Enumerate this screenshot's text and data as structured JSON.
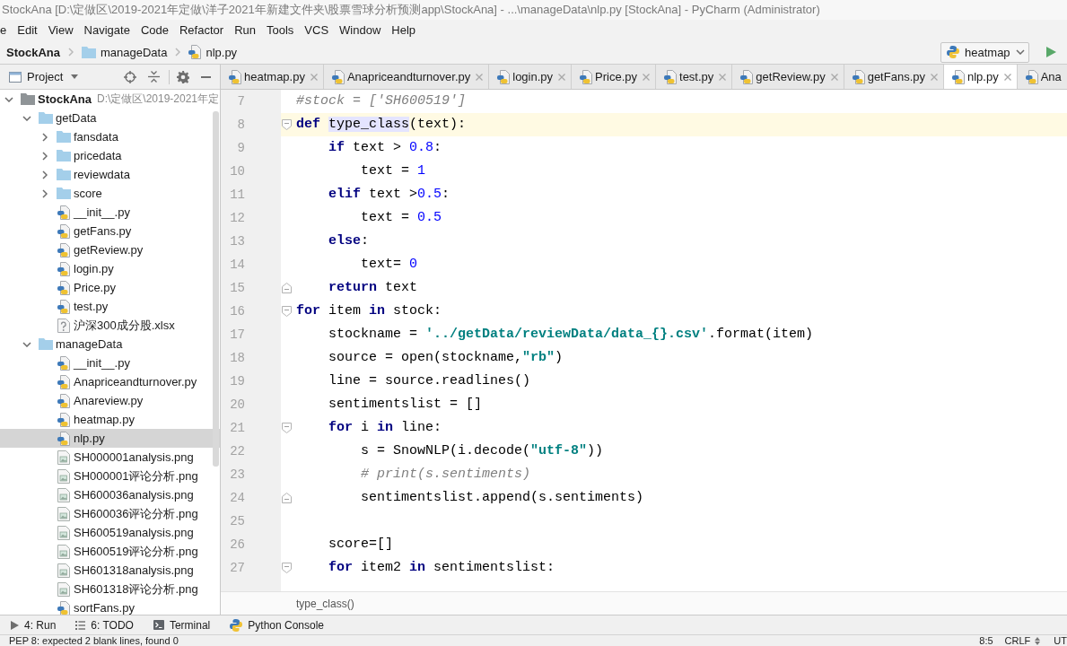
{
  "window": {
    "title": "StockAna [D:\\定做区\\2019-2021年定做\\洋子2021年新建文件夹\\股票雪球分析预测app\\StockAna] - ...\\manageData\\nlp.py [StockAna] - PyCharm (Administrator)"
  },
  "menu": [
    "e",
    "Edit",
    "View",
    "Navigate",
    "Code",
    "Refactor",
    "Run",
    "Tools",
    "VCS",
    "Window",
    "Help"
  ],
  "navigation": {
    "crumbs": [
      {
        "label": "StockAna",
        "kind": "root"
      },
      {
        "label": "manageData",
        "kind": "folder"
      },
      {
        "label": "nlp.py",
        "kind": "python"
      }
    ],
    "run_config": {
      "label": "heatmap"
    }
  },
  "project": {
    "title": "Project",
    "tree": [
      {
        "label": "StockAna",
        "path": "D:\\定做区\\2019-2021年定",
        "kind": "root",
        "expanded": true,
        "selected": false,
        "children": [
          {
            "label": "getData",
            "kind": "folder",
            "expanded": true,
            "selected": false,
            "children": [
              {
                "label": "fansdata",
                "kind": "folder",
                "expanded": false,
                "selected": false
              },
              {
                "label": "pricedata",
                "kind": "folder",
                "expanded": false,
                "selected": false
              },
              {
                "label": "reviewdata",
                "kind": "folder",
                "expanded": false,
                "selected": false
              },
              {
                "label": "score",
                "kind": "folder",
                "expanded": false,
                "selected": false
              },
              {
                "label": "__init__.py",
                "kind": "python",
                "selected": false
              },
              {
                "label": "getFans.py",
                "kind": "python",
                "selected": false
              },
              {
                "label": "getReview.py",
                "kind": "python",
                "selected": false
              },
              {
                "label": "login.py",
                "kind": "python",
                "selected": false
              },
              {
                "label": "Price.py",
                "kind": "python",
                "selected": false
              },
              {
                "label": "test.py",
                "kind": "python",
                "selected": false
              },
              {
                "label": "沪深300成分股.xlsx",
                "kind": "other",
                "selected": false
              }
            ]
          },
          {
            "label": "manageData",
            "kind": "folder",
            "expanded": true,
            "selected": false,
            "children": [
              {
                "label": "__init__.py",
                "kind": "python",
                "selected": false
              },
              {
                "label": "Anapriceandturnover.py",
                "kind": "python",
                "selected": false
              },
              {
                "label": "Anareview.py",
                "kind": "python",
                "selected": false
              },
              {
                "label": "heatmap.py",
                "kind": "python",
                "selected": false
              },
              {
                "label": "nlp.py",
                "kind": "python",
                "selected": true
              },
              {
                "label": "SH000001analysis.png",
                "kind": "image",
                "selected": false
              },
              {
                "label": "SH000001评论分析.png",
                "kind": "image",
                "selected": false
              },
              {
                "label": "SH600036analysis.png",
                "kind": "image",
                "selected": false
              },
              {
                "label": "SH600036评论分析.png",
                "kind": "image",
                "selected": false
              },
              {
                "label": "SH600519analysis.png",
                "kind": "image",
                "selected": false
              },
              {
                "label": "SH600519评论分析.png",
                "kind": "image",
                "selected": false
              },
              {
                "label": "SH601318analysis.png",
                "kind": "image",
                "selected": false
              },
              {
                "label": "SH601318评论分析.png",
                "kind": "image",
                "selected": false
              },
              {
                "label": "sortFans.py",
                "kind": "python",
                "selected": false
              }
            ]
          }
        ]
      }
    ]
  },
  "editor": {
    "tabs": [
      {
        "label": "heatmap.py",
        "selected": false,
        "closable": true
      },
      {
        "label": "Anapriceandturnover.py",
        "selected": false,
        "closable": true
      },
      {
        "label": "login.py",
        "selected": false,
        "closable": true
      },
      {
        "label": "Price.py",
        "selected": false,
        "closable": true
      },
      {
        "label": "test.py",
        "selected": false,
        "closable": true
      },
      {
        "label": "getReview.py",
        "selected": false,
        "closable": true
      },
      {
        "label": "getFans.py",
        "selected": false,
        "closable": true
      },
      {
        "label": "nlp.py",
        "selected": true,
        "closable": true
      },
      {
        "label": "Ana",
        "selected": false,
        "closable": false
      }
    ],
    "lines": [
      {
        "number": "7",
        "kind": "plain",
        "current": false,
        "tokens": [
          {
            "kind": "comment",
            "text": "#stock = ['SH600519']"
          }
        ]
      },
      {
        "number": "8",
        "kind": "fold_start",
        "current": true,
        "tokens": [
          {
            "kind": "keyword",
            "text": "def "
          },
          {
            "kind": "usage",
            "text": "type_class"
          },
          {
            "kind": "plain",
            "text": "(text):"
          }
        ]
      },
      {
        "number": "9",
        "kind": "plain",
        "current": false,
        "tokens": [
          {
            "kind": "keyword",
            "text": "    if"
          },
          {
            "kind": "plain",
            "text": " text > "
          },
          {
            "kind": "number",
            "text": "0.8"
          },
          {
            "kind": "plain",
            "text": ":"
          }
        ]
      },
      {
        "number": "10",
        "kind": "plain",
        "current": false,
        "tokens": [
          {
            "kind": "plain",
            "text": "        text = "
          },
          {
            "kind": "number",
            "text": "1"
          }
        ]
      },
      {
        "number": "11",
        "kind": "plain",
        "current": false,
        "tokens": [
          {
            "kind": "keyword",
            "text": "    elif"
          },
          {
            "kind": "plain",
            "text": " text >"
          },
          {
            "kind": "number",
            "text": "0.5"
          },
          {
            "kind": "plain",
            "text": ":"
          }
        ]
      },
      {
        "number": "12",
        "kind": "plain",
        "current": false,
        "tokens": [
          {
            "kind": "plain",
            "text": "        text = "
          },
          {
            "kind": "number",
            "text": "0.5"
          }
        ]
      },
      {
        "number": "13",
        "kind": "plain",
        "current": false,
        "tokens": [
          {
            "kind": "keyword",
            "text": "    else"
          },
          {
            "kind": "plain",
            "text": ":"
          }
        ]
      },
      {
        "number": "14",
        "kind": "plain",
        "current": false,
        "tokens": [
          {
            "kind": "plain",
            "text": "        text= "
          },
          {
            "kind": "number",
            "text": "0"
          }
        ]
      },
      {
        "number": "15",
        "kind": "fold_end",
        "current": false,
        "tokens": [
          {
            "kind": "keyword",
            "text": "    return"
          },
          {
            "kind": "plain",
            "text": " text"
          }
        ]
      },
      {
        "number": "16",
        "kind": "fold_start",
        "current": false,
        "tokens": [
          {
            "kind": "keyword",
            "text": "for"
          },
          {
            "kind": "plain",
            "text": " item "
          },
          {
            "kind": "keyword",
            "text": "in"
          },
          {
            "kind": "plain",
            "text": " stock:"
          }
        ]
      },
      {
        "number": "17",
        "kind": "plain",
        "current": false,
        "tokens": [
          {
            "kind": "plain",
            "text": "    stockname = "
          },
          {
            "kind": "string",
            "text": "'../getData/reviewData/data_{}.csv'"
          },
          {
            "kind": "plain",
            "text": ".format(item)"
          }
        ]
      },
      {
        "number": "18",
        "kind": "plain",
        "current": false,
        "tokens": [
          {
            "kind": "plain",
            "text": "    source = open(stockname,"
          },
          {
            "kind": "string",
            "text": "\"rb\""
          },
          {
            "kind": "plain",
            "text": ")"
          }
        ]
      },
      {
        "number": "19",
        "kind": "plain",
        "current": false,
        "tokens": [
          {
            "kind": "plain",
            "text": "    line = source.readlines()"
          }
        ]
      },
      {
        "number": "20",
        "kind": "plain",
        "current": false,
        "tokens": [
          {
            "kind": "plain",
            "text": "    sentimentslist = []"
          }
        ]
      },
      {
        "number": "21",
        "kind": "fold_start",
        "current": false,
        "tokens": [
          {
            "kind": "keyword",
            "text": "    for"
          },
          {
            "kind": "plain",
            "text": " i "
          },
          {
            "kind": "keyword",
            "text": "in"
          },
          {
            "kind": "plain",
            "text": " line:"
          }
        ]
      },
      {
        "number": "22",
        "kind": "plain",
        "current": false,
        "tokens": [
          {
            "kind": "plain",
            "text": "        s = SnowNLP(i.decode("
          },
          {
            "kind": "string",
            "text": "\"utf-8\""
          },
          {
            "kind": "plain",
            "text": "))"
          }
        ]
      },
      {
        "number": "23",
        "kind": "plain",
        "current": false,
        "tokens": [
          {
            "kind": "comment",
            "text": "        # print(s.sentiments)"
          }
        ]
      },
      {
        "number": "24",
        "kind": "fold_end",
        "current": false,
        "tokens": [
          {
            "kind": "plain",
            "text": "        sentimentslist.append(s.sentiments)"
          }
        ]
      },
      {
        "number": "25",
        "kind": "plain",
        "current": false
      },
      {
        "number": "26",
        "kind": "plain",
        "current": false,
        "tokens": [
          {
            "kind": "plain",
            "text": "    score=[]"
          }
        ]
      },
      {
        "number": "27",
        "kind": "fold_start",
        "current": false,
        "tokens": [
          {
            "kind": "keyword",
            "text": "    for"
          },
          {
            "kind": "plain",
            "text": " item2 "
          },
          {
            "kind": "keyword",
            "text": "in"
          },
          {
            "kind": "plain",
            "text": " sentimentslist:"
          }
        ]
      }
    ],
    "breadcrumb": "type_class()"
  },
  "tool_buttons": [
    {
      "label": "4: Run",
      "kind": "run"
    },
    {
      "label": "6: TODO",
      "kind": "todo"
    },
    {
      "label": "Terminal",
      "kind": "terminal"
    },
    {
      "label": "Python Console",
      "kind": "console"
    }
  ],
  "status_bar": {
    "message": "PEP 8: expected 2 blank lines, found 0",
    "position": "8:5",
    "line_separator": "CRLF",
    "encoding": "UT"
  }
}
